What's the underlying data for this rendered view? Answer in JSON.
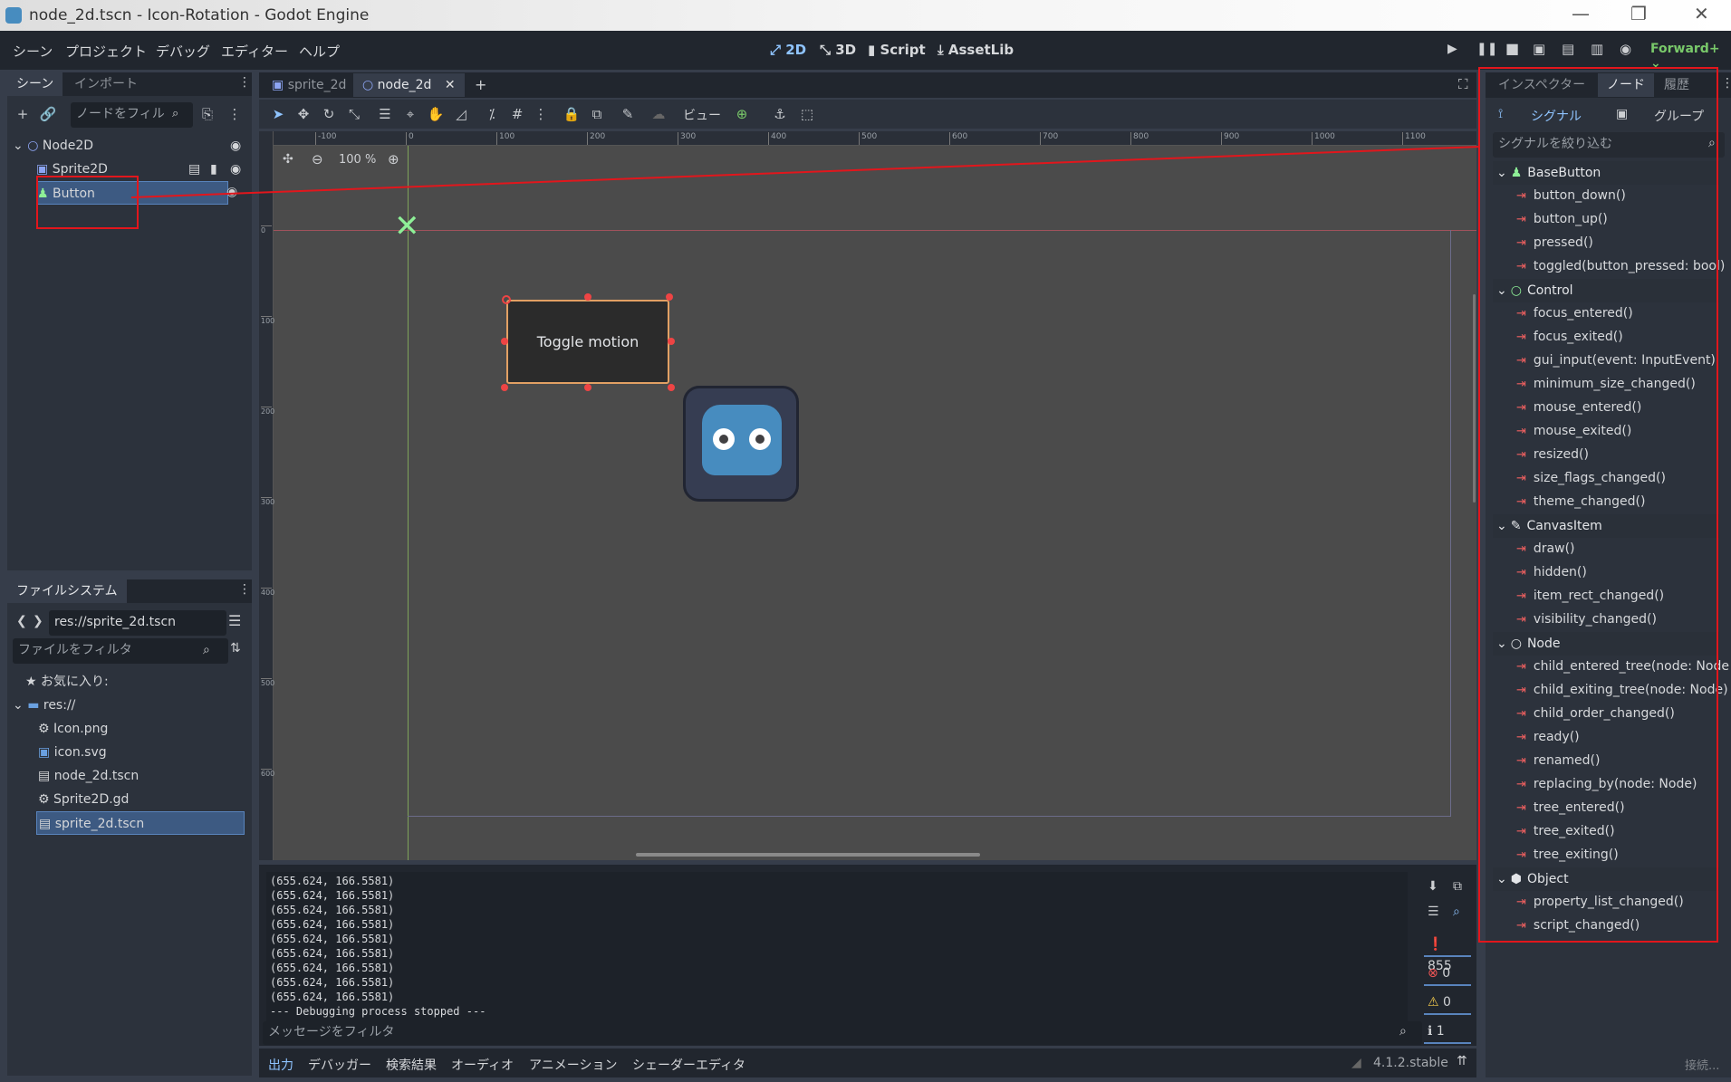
{
  "window": {
    "title": "node_2d.tscn - Icon-Rotation - Godot Engine"
  },
  "menu": [
    "シーン",
    "プロジェクト",
    "デバッグ",
    "エディター",
    "ヘルプ"
  ],
  "modes": {
    "m2d": "2D",
    "m3d": "3D",
    "script": "Script",
    "assetlib": "AssetLib"
  },
  "renderer": "Forward+",
  "scene_dock": {
    "tabs": [
      "シーン",
      "インポート"
    ],
    "filter_placeholder": "ノードをフィル",
    "nodes": [
      "Node2D",
      "Sprite2D",
      "Button"
    ]
  },
  "fs_dock": {
    "tab": "ファイルシステム",
    "path": "res://sprite_2d.tscn",
    "filter_placeholder": "ファイルをフィルタ",
    "favorites": "お気に入り:",
    "root": "res://",
    "files": [
      "Icon.png",
      "icon.svg",
      "node_2d.tscn",
      "Sprite2D.gd",
      "sprite_2d.tscn"
    ]
  },
  "editor_tabs": [
    "sprite_2d",
    "node_2d"
  ],
  "toolbar": {
    "view": "ビュー"
  },
  "viewport": {
    "zoom": "100 %",
    "button_text": "Toggle motion",
    "ruler_ticks": [
      "-100",
      "0",
      "100",
      "200",
      "300",
      "400",
      "500",
      "600",
      "700",
      "800",
      "900",
      "1000",
      "1100"
    ],
    "vruler_ticks": [
      "0",
      "100",
      "200",
      "300",
      "400",
      "500",
      "600"
    ]
  },
  "output": {
    "lines": [
      "(655.624, 166.5581)",
      "(655.624, 166.5581)",
      "(655.624, 166.5581)",
      "(655.624, 166.5581)",
      "(655.624, 166.5581)",
      "(655.624, 166.5581)",
      "(655.624, 166.5581)",
      "(655.624, 166.5581)",
      "(655.624, 166.5581)",
      "--- Debugging process stopped ---"
    ],
    "filter_placeholder": "メッセージをフィルタ",
    "counts": {
      "messages": "855",
      "errors": "0",
      "warnings": "0",
      "info": "1"
    }
  },
  "bottom_tabs": [
    "出力",
    "デバッガー",
    "検索結果",
    "オーディオ",
    "アニメーション",
    "シェーダーエディタ"
  ],
  "version": "4.1.2.stable",
  "right_dock": {
    "tabs": [
      "インスペクター",
      "ノード",
      "履歴"
    ],
    "subtabs": [
      "シグナル",
      "グループ"
    ],
    "filter_placeholder": "シグナルを絞り込む",
    "status": "接続...",
    "classes": [
      {
        "name": "BaseButton",
        "icon": "button-icon",
        "signals": [
          "button_down()",
          "button_up()",
          "pressed()",
          "toggled(button_pressed: bool)"
        ]
      },
      {
        "name": "Control",
        "icon": "control-icon",
        "signals": [
          "focus_entered()",
          "focus_exited()",
          "gui_input(event: InputEvent)",
          "minimum_size_changed()",
          "mouse_entered()",
          "mouse_exited()",
          "resized()",
          "size_flags_changed()",
          "theme_changed()"
        ]
      },
      {
        "name": "CanvasItem",
        "icon": "canvasitem-icon",
        "signals": [
          "draw()",
          "hidden()",
          "item_rect_changed()",
          "visibility_changed()"
        ]
      },
      {
        "name": "Node",
        "icon": "node-icon",
        "signals": [
          "child_entered_tree(node: Node)",
          "child_exiting_tree(node: Node)",
          "child_order_changed()",
          "ready()",
          "renamed()",
          "replacing_by(node: Node)",
          "tree_entered()",
          "tree_exited()",
          "tree_exiting()"
        ]
      },
      {
        "name": "Object",
        "icon": "object-icon",
        "signals": [
          "property_list_changed()",
          "script_changed()"
        ]
      }
    ]
  }
}
